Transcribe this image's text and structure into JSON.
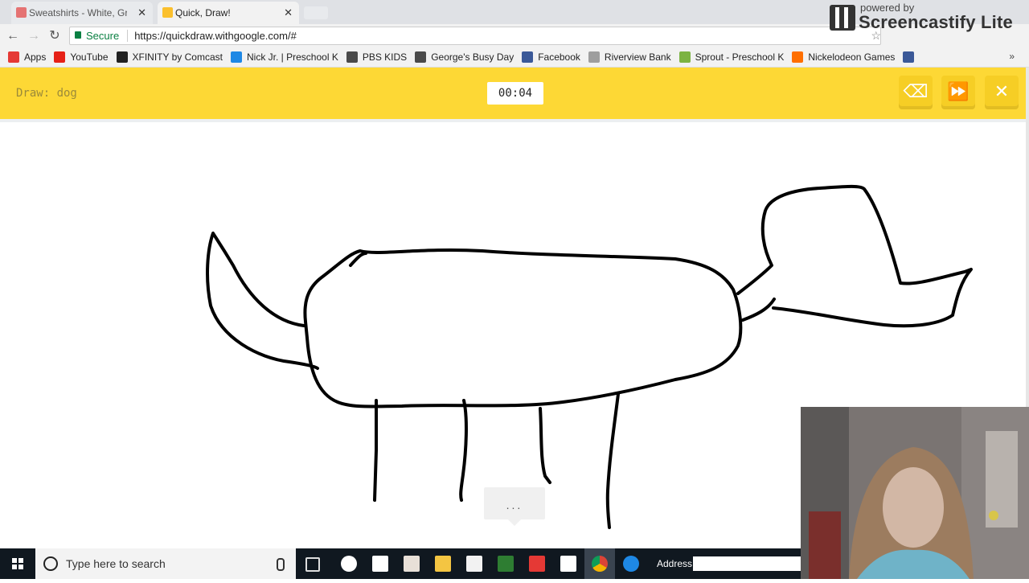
{
  "tabs": [
    {
      "label": "Sweatshirts - White, Grey",
      "active": false,
      "favicon_color": "#e57373"
    },
    {
      "label": "Quick, Draw!",
      "active": true,
      "favicon_color": "#fbc02d"
    }
  ],
  "address_bar": {
    "secure_label": "Secure",
    "url": "https://quickdraw.withgoogle.com/#"
  },
  "bookmarks": [
    {
      "label": "Apps",
      "icon": "apps-grid-icon",
      "color": "#e53935"
    },
    {
      "label": "YouTube",
      "icon": "youtube-icon",
      "color": "#e62117"
    },
    {
      "label": "XFINITY by Comcast",
      "icon": "xfinity-icon",
      "color": "#222222"
    },
    {
      "label": "Nick Jr. | Preschool K",
      "icon": "nickjr-icon",
      "color": "#1e88e5"
    },
    {
      "label": "PBS KIDS",
      "icon": "pbs-kids-icon",
      "color": "#4a4a4a"
    },
    {
      "label": "George's Busy Day",
      "icon": "pbs-kids-icon",
      "color": "#4a4a4a"
    },
    {
      "label": "Facebook",
      "icon": "facebook-icon",
      "color": "#3b5998"
    },
    {
      "label": "Riverview Bank",
      "icon": "page-icon",
      "color": "#9e9e9e"
    },
    {
      "label": "Sprout - Preschool K",
      "icon": "sprout-icon",
      "color": "#7cb342"
    },
    {
      "label": "Nickelodeon Games",
      "icon": "nickelodeon-icon",
      "color": "#ff6f00"
    },
    {
      "label": "",
      "icon": "facebook-icon",
      "color": "#3b5998"
    }
  ],
  "bookmarks_overflow": "»",
  "watermark": {
    "powered_by": "powered by",
    "name": "Screencastify Lite"
  },
  "quickdraw": {
    "prompt": "Draw: dog",
    "timer": "00:04",
    "guess_bubble": "...",
    "buttons": [
      {
        "name": "clear-canvas-button",
        "icon": "eraser-icon",
        "glyph": "⌫"
      },
      {
        "name": "skip-button",
        "icon": "skip-forward-icon",
        "glyph": "⏩"
      },
      {
        "name": "close-button",
        "icon": "close-icon",
        "glyph": "✕"
      }
    ],
    "accent_color": "#fdd835"
  },
  "taskbar": {
    "search_placeholder": "Type here to search",
    "address_label": "Address"
  }
}
